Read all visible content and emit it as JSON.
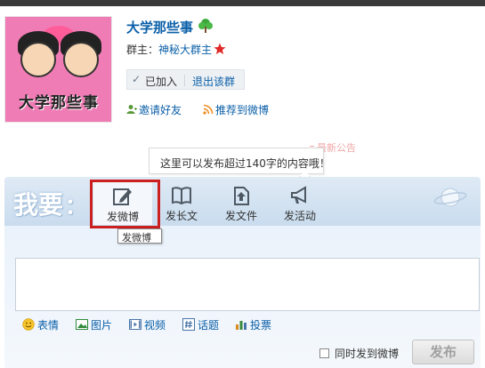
{
  "group": {
    "avatar_art_text": "大学那些事",
    "name": "大学那些事",
    "owner_label": "群主：",
    "owner_name": "神秘大群主",
    "joined_label": "已加入",
    "quit_label": "退出该群",
    "invite_label": "邀请好友",
    "recommend_label": "推荐到微博"
  },
  "notice": {
    "label": "最新公告",
    "tip_text": "这里可以发布超过140字的内容哦！"
  },
  "publisher": {
    "heading": "我要",
    "heading_colon": "：",
    "tabs": [
      {
        "label": "发微博",
        "icon": "pencil-icon"
      },
      {
        "label": "发长文",
        "icon": "book-icon"
      },
      {
        "label": "发文件",
        "icon": "file-upload-icon"
      },
      {
        "label": "发活动",
        "icon": "megaphone-icon"
      }
    ],
    "active_tab": 0,
    "tooltip": "发微博",
    "textarea_value": "",
    "tools": {
      "emoji": "表情",
      "picture": "图片",
      "video": "视频",
      "topic": "话题",
      "vote": "投票"
    },
    "sync_label": "同时发到微博",
    "sync_checked": false,
    "post_label": "发布"
  },
  "colors": {
    "link": "#0a5fa8",
    "highlight_frame": "#cc1f1f",
    "banner": "#c9dcee"
  }
}
